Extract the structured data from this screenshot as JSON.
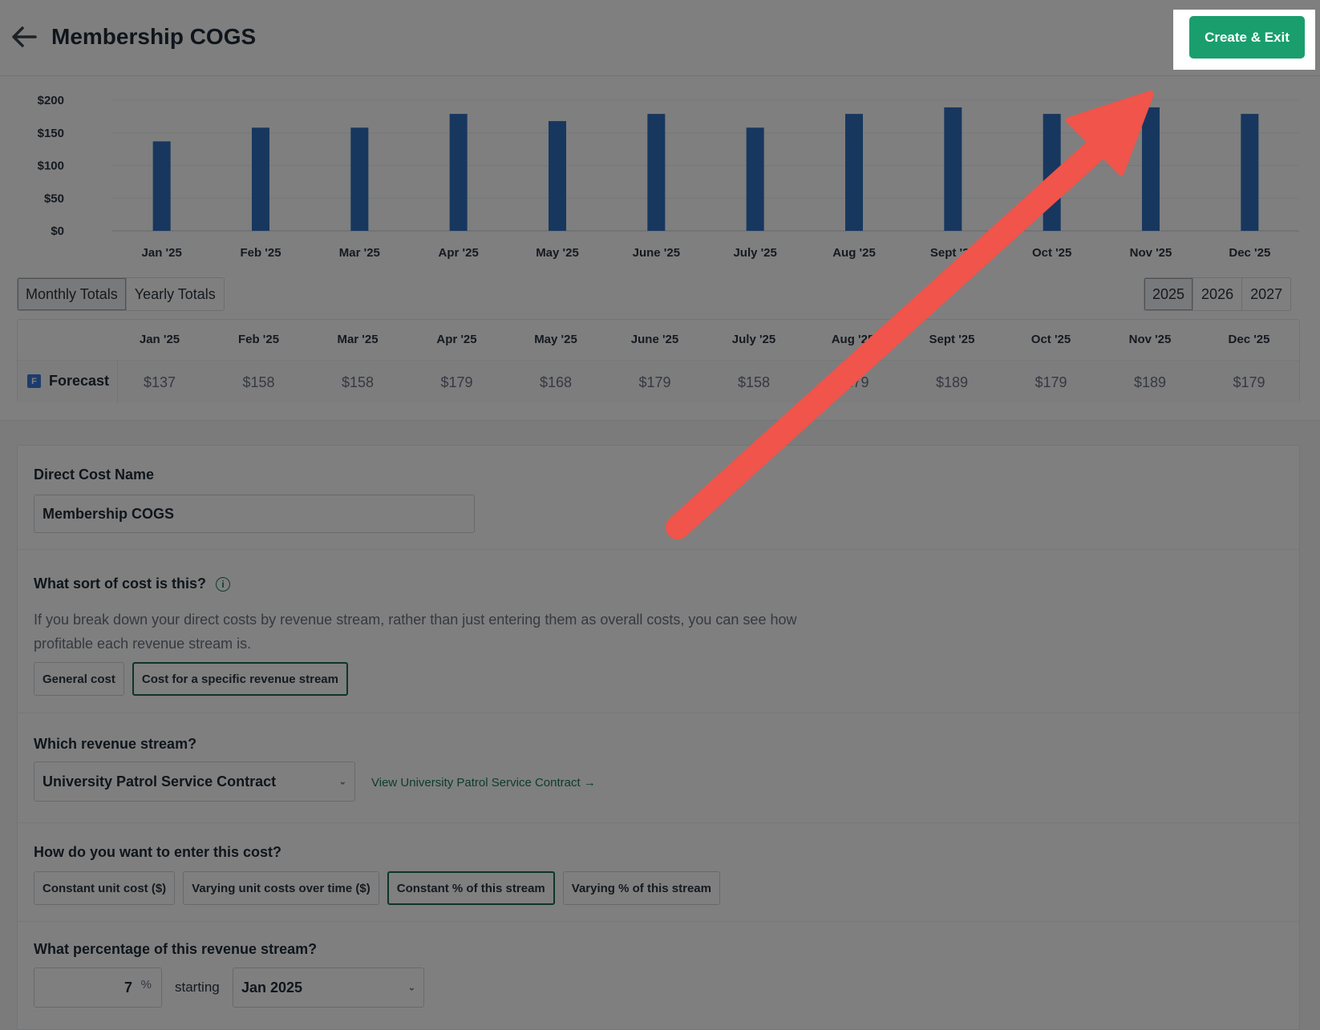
{
  "header": {
    "title": "Membership COGS",
    "back_icon": "arrow-left-icon",
    "create_exit_label": "Create & Exit"
  },
  "chart_data": {
    "type": "bar",
    "categories": [
      "Jan '25",
      "Feb '25",
      "Mar '25",
      "Apr '25",
      "May '25",
      "June '25",
      "July '25",
      "Aug '25",
      "Sept '25",
      "Oct '25",
      "Nov '25",
      "Dec '25"
    ],
    "values": [
      137,
      158,
      158,
      179,
      168,
      179,
      158,
      179,
      189,
      179,
      189,
      179
    ],
    "y_ticks": [
      "$200",
      "$150",
      "$100",
      "$50",
      "$0"
    ],
    "ylim": [
      0,
      200
    ],
    "bar_color": "#2f6fbf",
    "grid": true
  },
  "totals_toggle": {
    "monthly": "Monthly Totals",
    "yearly": "Yearly Totals",
    "active": "monthly"
  },
  "year_toggle": {
    "years": [
      "2025",
      "2026",
      "2027"
    ],
    "active": "2025"
  },
  "totals_table": {
    "row_label": "Forecast",
    "badge": "F",
    "months": [
      "Jan '25",
      "Feb '25",
      "Mar '25",
      "Apr '25",
      "May '25",
      "June '25",
      "July '25",
      "Aug '25",
      "Sept '25",
      "Oct '25",
      "Nov '25",
      "Dec '25"
    ],
    "values": [
      "$137",
      "$158",
      "$158",
      "$179",
      "$168",
      "$179",
      "$158",
      "$179",
      "$189",
      "$179",
      "$189",
      "$179"
    ]
  },
  "form": {
    "name_label": "Direct Cost Name",
    "name_value": "Membership COGS",
    "cost_type_label": "What sort of cost is this?",
    "cost_type_help": "If you break down your direct costs by revenue stream, rather than just entering them as overall costs, you can see how profitable each revenue stream is.",
    "cost_type_options": [
      "General cost",
      "Cost for a specific revenue stream"
    ],
    "cost_type_selected": 1,
    "stream_label": "Which revenue stream?",
    "stream_value": "University Patrol Service Contract",
    "stream_link": "View University Patrol Service Contract →",
    "entry_label": "How do you want to enter this cost?",
    "entry_options": [
      "Constant unit cost ($)",
      "Varying unit costs over time ($)",
      "Constant % of this stream",
      "Varying % of this stream"
    ],
    "entry_selected": 2,
    "pct_label": "What percentage of this revenue stream?",
    "pct_value": "7",
    "pct_unit": "%",
    "starting_label": "starting",
    "starting_value": "Jan 2025"
  },
  "annotation": {
    "arrow_color": "#f0544a"
  }
}
